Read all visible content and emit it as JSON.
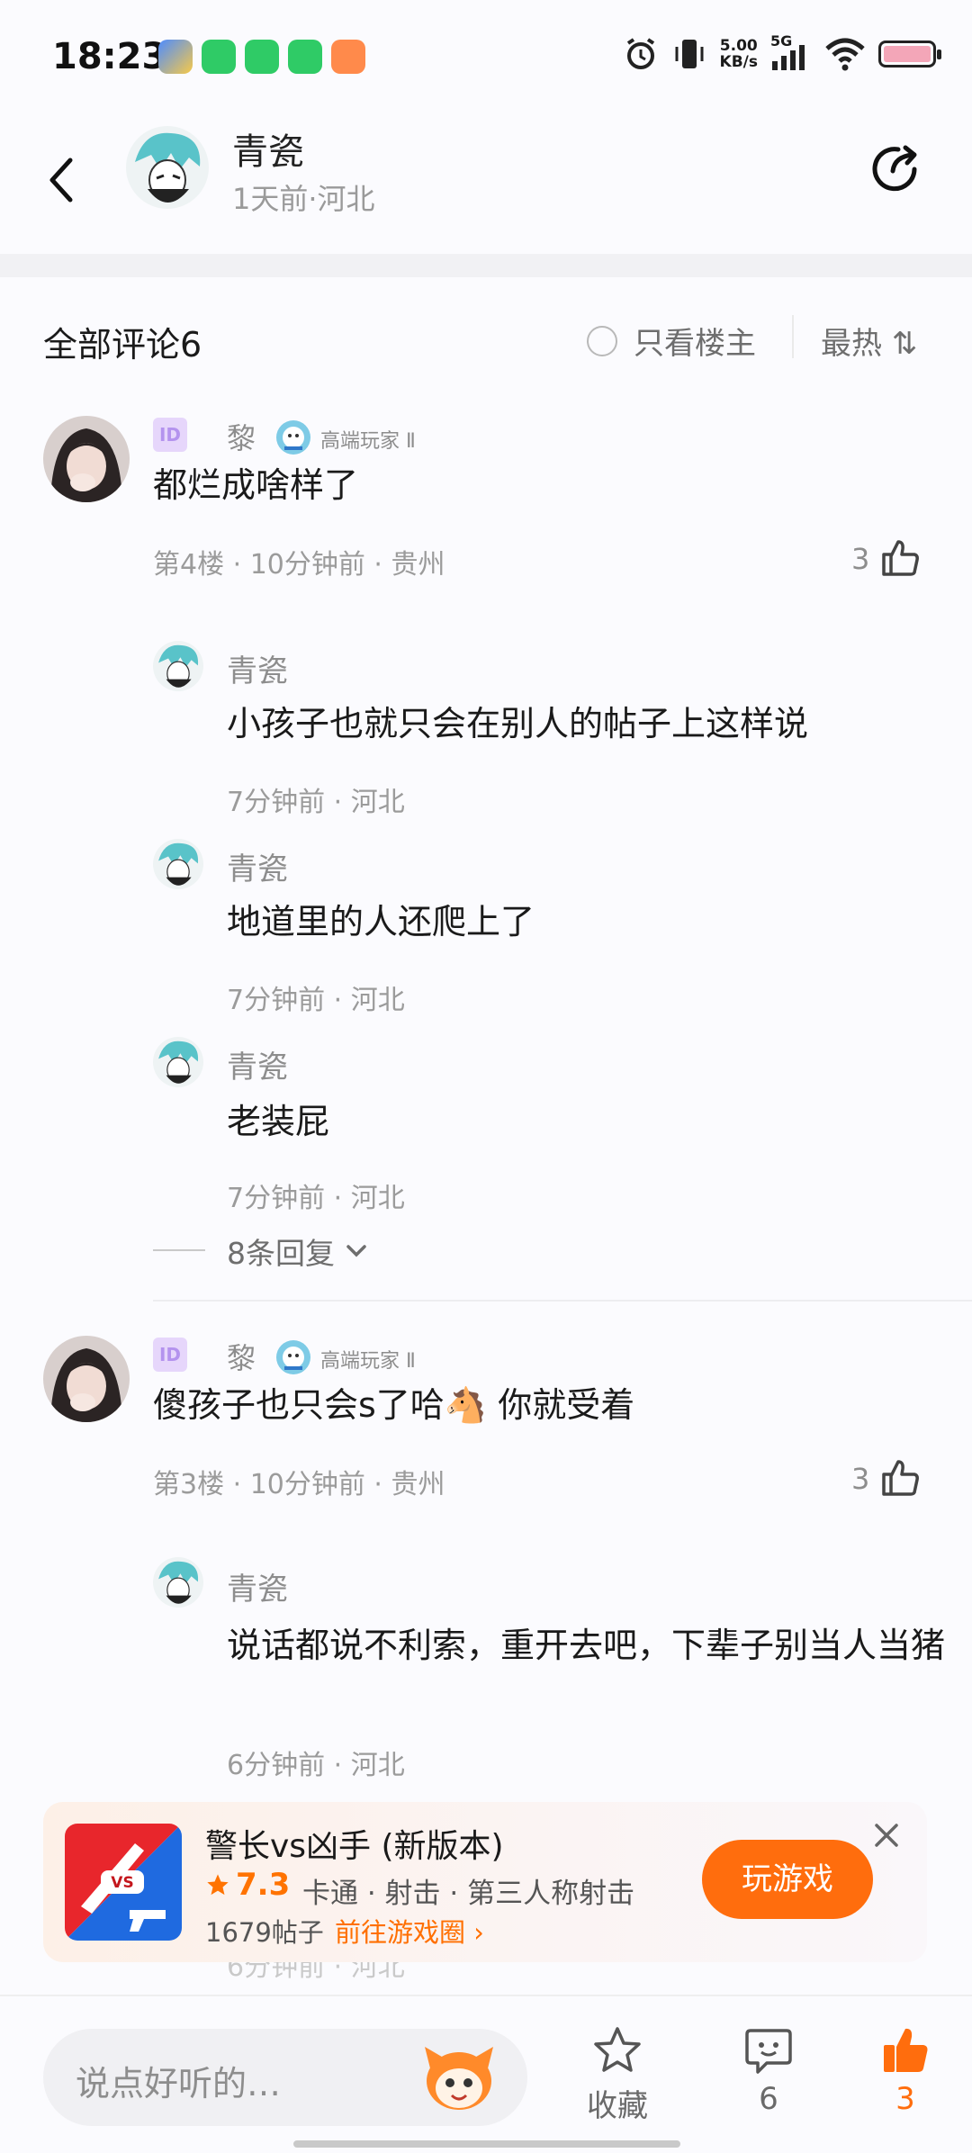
{
  "status_bar": {
    "time": "18:23",
    "net_speed_value": "5.00",
    "net_speed_unit": "KB/s",
    "network": "5G",
    "app_icons": [
      "#4e8cff",
      "#2fcb66",
      "#2fcb66",
      "#2fcb66",
      "#ff8a4b"
    ]
  },
  "header": {
    "author_name": "青瓷",
    "meta": "1天前·河北",
    "back_icon": "chevron-left-icon",
    "share_icon": "share-icon"
  },
  "comments_header": {
    "title": "全部评论6",
    "only_author": "只看楼主",
    "sort": "最热 ⇅"
  },
  "comments": [
    {
      "id_badge": "ID",
      "name": "黎",
      "level": "高端玩家 Ⅱ",
      "text": "都烂成啥样了",
      "meta": "第4楼 · 10分钟前 · 贵州",
      "likes": "3",
      "replies": [
        {
          "name": "青瓷",
          "text": "小孩子也就只会在别人的帖子上这样说",
          "meta": "7分钟前 · 河北"
        },
        {
          "name": "青瓷",
          "text": "地道里的人还爬上了",
          "meta": "7分钟前 · 河北"
        },
        {
          "name": "青瓷",
          "text": "老装屁",
          "meta": "7分钟前 · 河北"
        }
      ],
      "more_replies": "8条回复"
    },
    {
      "id_badge": "ID",
      "name": "黎",
      "level": "高端玩家 Ⅱ",
      "text": "傻孩子也只会s了哈🐴 你就受着",
      "meta": "第3楼 · 10分钟前 · 贵州",
      "likes": "3",
      "replies": [
        {
          "name": "青瓷",
          "text": "说话都说不利索，重开去吧，下辈子别当人当猪",
          "meta": "6分钟前 · 河北"
        }
      ]
    }
  ],
  "ad": {
    "title": "警长vs凶手 (新版本)",
    "rating": "7.3",
    "tags": "卡通 · 射击 · 第三人称射击",
    "posts": "1679帖子",
    "link": "前往游戏圈 ›",
    "button": "玩游戏",
    "icon_text": "VS"
  },
  "ghost_meta": "6分钟前 · 河北",
  "bottom_bar": {
    "input_placeholder": "说点好听的…",
    "favorite_label": "收藏",
    "comment_count": "6",
    "like_count": "3",
    "accent": "#ff6d0d"
  }
}
